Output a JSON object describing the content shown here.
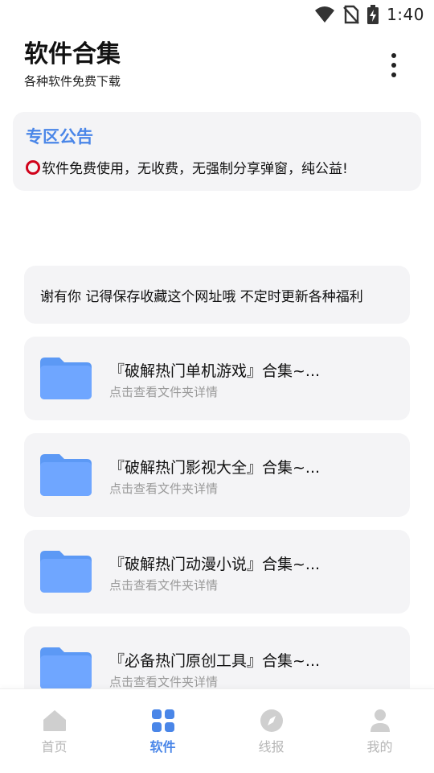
{
  "status_bar": {
    "time": "1:40",
    "icons": [
      "wifi-icon",
      "no-sim-icon",
      "battery-charging-icon"
    ]
  },
  "header": {
    "title": "软件合集",
    "subtitle": "各种软件免费下载",
    "menu_icon": "more-vertical-icon"
  },
  "notice": {
    "title": "专区公告",
    "icon": "circle-icon",
    "text": "软件免费使用，无收费，无强制分享弹窗，纯公益!"
  },
  "marquee": {
    "text": "谢有你 记得保存收藏这个网址哦 不定时更新各种福利"
  },
  "folders": [
    {
      "title": "『破解热门单机游戏』合集~...",
      "subtitle": "点击查看文件夹详情",
      "icon": "folder-icon"
    },
    {
      "title": "『破解热门影视大全』合集~...",
      "subtitle": "点击查看文件夹详情",
      "icon": "folder-icon"
    },
    {
      "title": "『破解热门动漫小说』合集~...",
      "subtitle": "点击查看文件夹详情",
      "icon": "folder-icon"
    },
    {
      "title": "『必备热门原创工具』合集~...",
      "subtitle": "点击查看文件夹详情",
      "icon": "folder-icon"
    }
  ],
  "bottom_nav": {
    "items": [
      {
        "label": "首页",
        "icon": "home-icon",
        "active": false
      },
      {
        "label": "软件",
        "icon": "grid-icon",
        "active": true
      },
      {
        "label": "线报",
        "icon": "compass-icon",
        "active": false
      },
      {
        "label": "我的",
        "icon": "user-icon",
        "active": false
      }
    ]
  },
  "colors": {
    "accent": "#4a86e8",
    "card_bg": "#f4f4f6",
    "folder": "#6fa6ff",
    "inactive": "#c8c8c8",
    "notice_icon": "#d0021b"
  }
}
